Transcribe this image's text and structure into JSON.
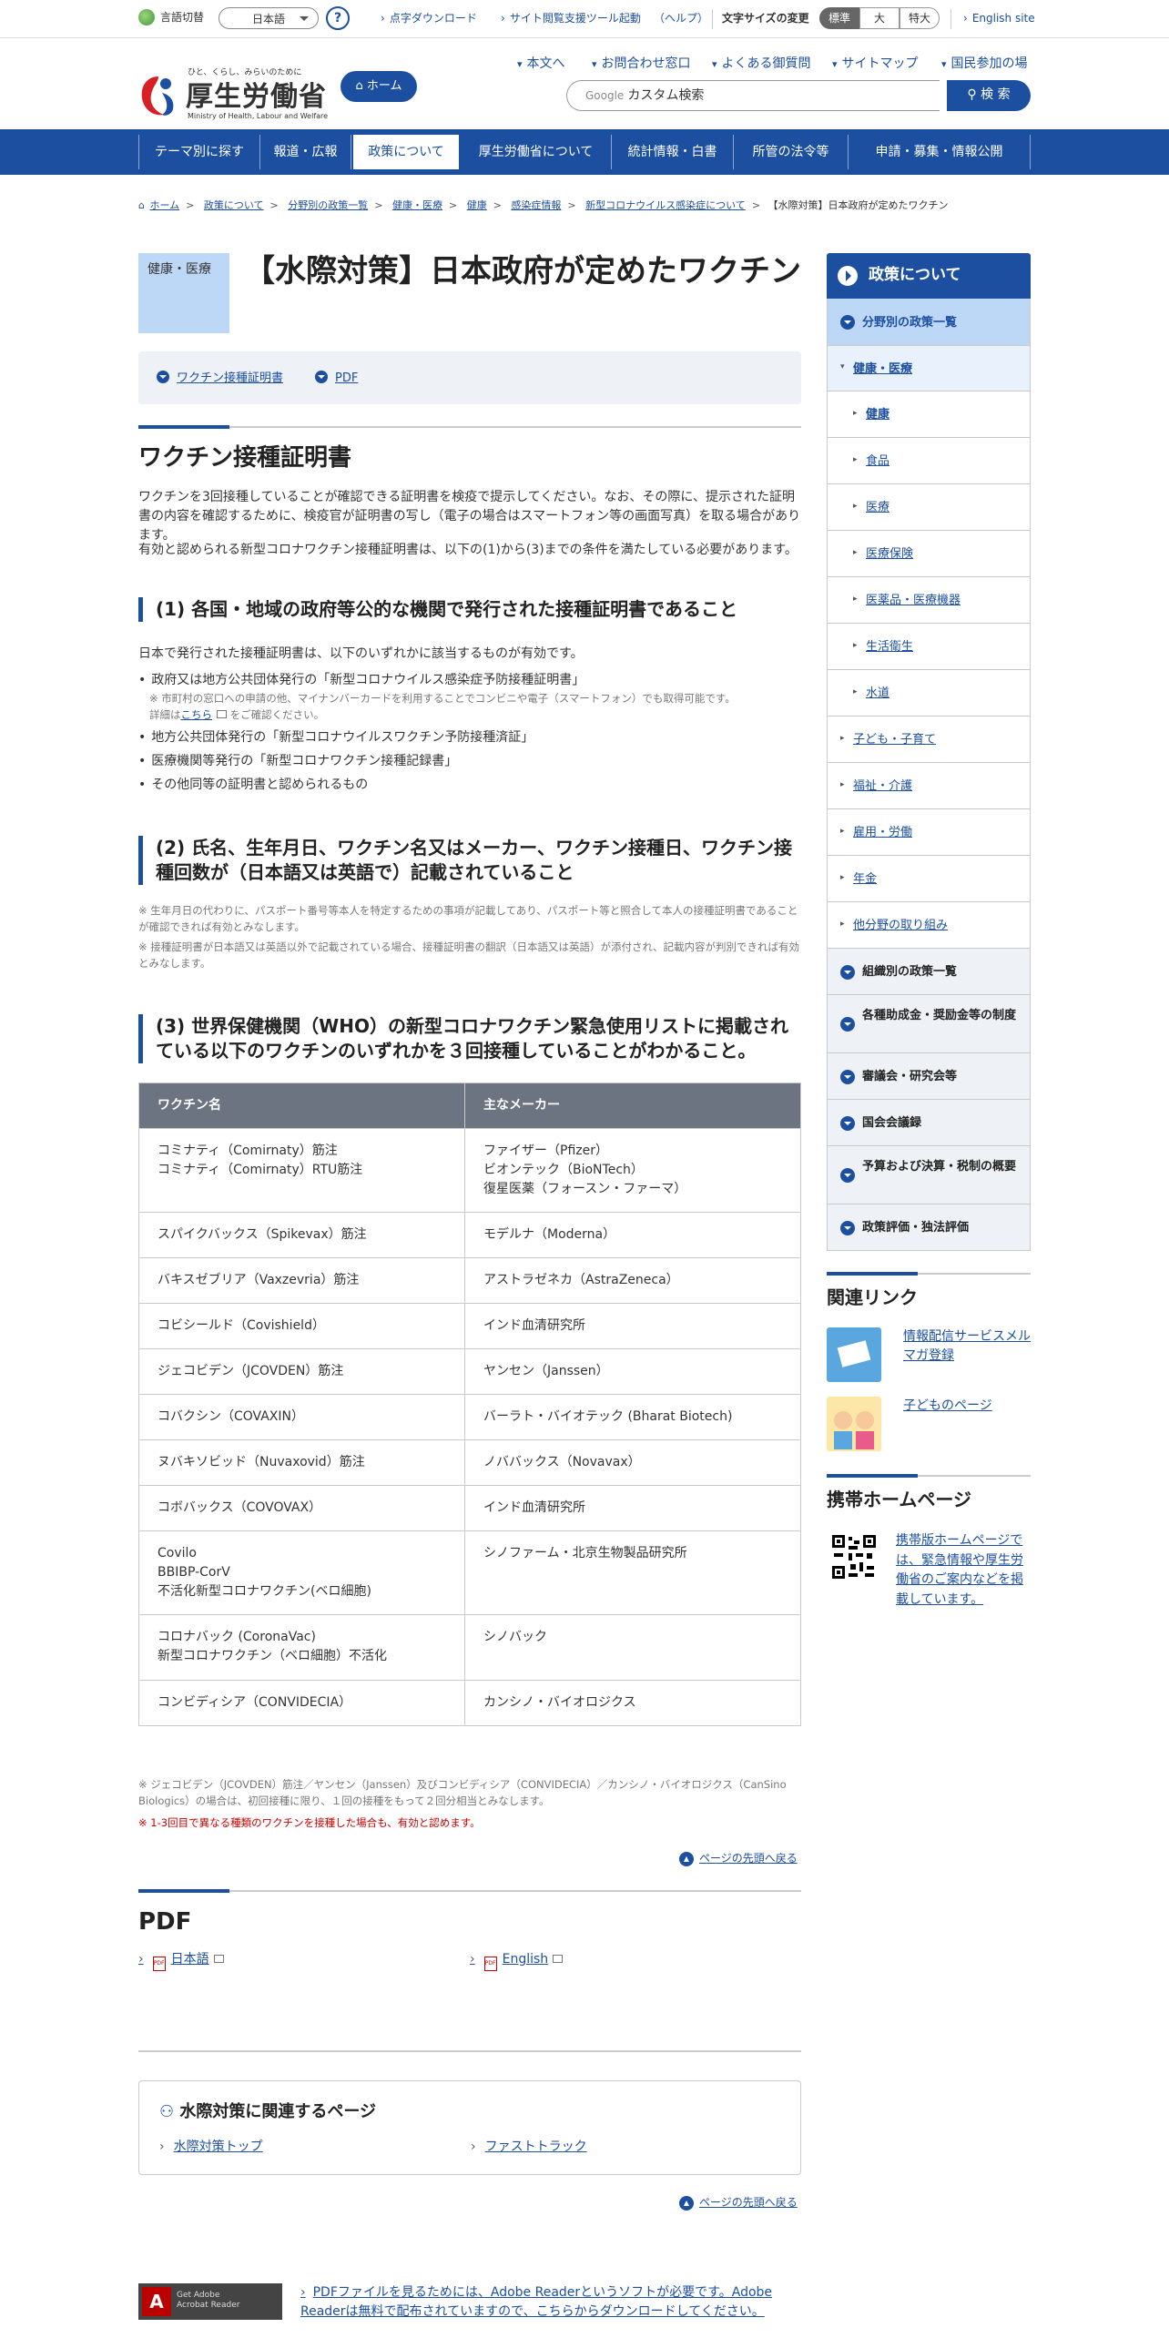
{
  "utility": {
    "lang_label": "言語切替",
    "lang_value": "日本語",
    "help": "?",
    "links": [
      "点字ダウンロード",
      "サイト閲覧支援ツール起動",
      "（ヘルプ）"
    ],
    "fontsize_label": "文字サイズの変更",
    "fontsize": [
      "標準",
      "大",
      "特大"
    ],
    "english": "English site"
  },
  "header": {
    "logo_tag": "ひと、くらし、みらいのために",
    "logo_name": "厚生労働省",
    "logo_en": "Ministry of Health, Labour and Welfare",
    "home": "ホーム",
    "links": [
      "本文へ",
      "お問合わせ窓口",
      "よくある御質問",
      "サイトマップ",
      "国民参加の場"
    ],
    "search_brand": "Google",
    "search_placeholder": "カスタム検索",
    "search_button": "検 索"
  },
  "gnav": [
    "テーマ別に探す",
    "報道・広報",
    "政策について",
    "厚生労働省について",
    "統計情報・白書",
    "所管の法令等",
    "申請・募集・情報公開"
  ],
  "breadcrumb": [
    "ホーム",
    "政策について",
    "分野別の政策一覧",
    "健康・医療",
    "健康",
    "感染症情報",
    "新型コロナウイルス感染症について",
    "【水際対策】日本政府が定めたワクチン"
  ],
  "page": {
    "category": "健康・医療",
    "title": "【水際対策】日本政府が定めたワクチン",
    "toc": [
      "ワクチン接種証明書",
      "PDF"
    ]
  },
  "section1": {
    "heading": "ワクチン接種証明書",
    "intro1": "ワクチンを3回接種していることが確認できる証明書を検疫で提示してください。なお、その際に、提示された証明書の内容を確認するために、検疫官が証明書の写し（電子の場合はスマートフォン等の画面写真）を取る場合があります。",
    "intro2": "有効と認められる新型コロナワクチン接種証明書は、以下の(1)から(3)までの条件を満たしている必要があります。",
    "c1_heading": "(1) 各国・地域の政府等公的な機関で発行された接種証明書であること",
    "c1_text": "日本で発行された接種証明書は、以下のいずれかに該当するものが有効です。",
    "c1_items": [
      "政府又は地方公共団体発行の「新型コロナウイルス感染症予防接種証明書」",
      "地方公共団体発行の「新型コロナウイルスワクチン予防接種済証」",
      "医療機関等発行の「新型コロナワクチン接種記録書」",
      "その他同等の証明書と認められるもの"
    ],
    "c1_note1": "※ 市町村の窓口への申請の他、マイナンバーカードを利用することでコンビニや電子（スマートフォン）でも取得可能です。",
    "c1_note2a": "詳細は",
    "c1_note2b": "こちら",
    "c1_note2c": "をご確認ください。",
    "c2_heading": "(2) 氏名、生年月日、ワクチン名又はメーカー、ワクチン接種日、ワクチン接種回数が（日本語又は英語で）記載されていること",
    "c2_note1": "※ 生年月日の代わりに、パスポート番号等本人を特定するための事項が記載してあり、パスポート等と照合して本人の接種証明書であることが確認できれば有効とみなします。",
    "c2_note2": "※ 接種証明書が日本語又は英語以外で記載されている場合、接種証明書の翻訳（日本語又は英語）が添付され、記載内容が判別できれば有効とみなします。",
    "c3_heading": "(3) 世界保健機関（WHO）の新型コロナワクチン緊急使用リストに掲載されている以下のワクチンのいずれかを３回接種していることがわかること。"
  },
  "vaccine_table": {
    "headers": [
      "ワクチン名",
      "主なメーカー"
    ],
    "rows": [
      {
        "name": [
          "コミナティ（Comirnaty）筋注",
          "コミナティ（Comirnaty）RTU筋注"
        ],
        "maker": [
          "ファイザー（Pfizer）",
          "ビオンテック（BioNTech）",
          "復星医薬（フォースン・ファーマ）"
        ]
      },
      {
        "name": [
          "スパイクバックス（Spikevax）筋注"
        ],
        "maker": [
          "モデルナ（Moderna）"
        ]
      },
      {
        "name": [
          "バキスゼブリア（Vaxzevria）筋注"
        ],
        "maker": [
          "アストラゼネカ（AstraZeneca）"
        ]
      },
      {
        "name": [
          "コビシールド（Covishield）"
        ],
        "maker": [
          "インド血清研究所"
        ]
      },
      {
        "name": [
          "ジェコビデン（JCOVDEN）筋注"
        ],
        "maker": [
          "ヤンセン（Janssen）"
        ]
      },
      {
        "name": [
          "コバクシン（COVAXIN）"
        ],
        "maker": [
          "バーラト・バイオテック (Bharat Biotech)"
        ]
      },
      {
        "name": [
          "ヌバキソビッド（Nuvaxovid）筋注"
        ],
        "maker": [
          "ノババックス（Novavax）"
        ]
      },
      {
        "name": [
          "コボバックス（COVOVAX）"
        ],
        "maker": [
          "インド血清研究所"
        ]
      },
      {
        "name": [
          "Covilo",
          "BBIBP-CorV",
          "不活化新型コロナワクチン(ベロ細胞)"
        ],
        "maker": [
          "シノファーム・北京生物製品研究所"
        ]
      },
      {
        "name": [
          "コロナバック (CoronaVac)",
          "新型コロナワクチン（ベロ細胞）不活化"
        ],
        "maker": [
          "シノバック"
        ]
      },
      {
        "name": [
          "コンビディシア（CONVIDECIA）"
        ],
        "maker": [
          "カンシノ・バイオロジクス"
        ]
      }
    ]
  },
  "table_notes": {
    "note1": "※ ジェコビデン（JCOVDEN）筋注／ヤンセン（Janssen）及びコンビディシア（CONVIDECIA）／カンシノ・バイオロジクス（CanSino Biologics）の場合は、初回接種に限り、１回の接種をもって２回分相当とみなします。",
    "note2": "※ 1-3回目で異なる種類のワクチンを接種した場合も、有効と認めます。"
  },
  "to_top": "ページの先頭へ戻る",
  "pdf_section": {
    "heading": "PDF",
    "links": [
      "日本語",
      "English"
    ],
    "icon": "PDF"
  },
  "related_pages": {
    "title": "水際対策に関連するページ",
    "links": [
      "水際対策トップ",
      "ファストトラック"
    ]
  },
  "adobe": {
    "badge1": "Get Adobe",
    "badge2": "Acrobat Reader",
    "text": "PDFファイルを見るためには、Adobe Readerというソフトが必要です。Adobe Readerは無料で配布されていますので、こちらからダウンロードしてください。"
  },
  "sidebar": {
    "title": "政策について",
    "items": [
      "分野別の政策一覧",
      "健康・医療",
      "健康",
      "食品",
      "医療",
      "医療保険",
      "医薬品・医療機器",
      "生活衛生",
      "水道",
      "子ども・子育て",
      "福祉・介護",
      "雇用・労働",
      "年金",
      "他分野の取り組み",
      "組織別の政策一覧",
      "各種助成金・奨励金等の制度",
      "審議会・研究会等",
      "国会会議録",
      "予算および決算・税制の概要",
      "政策評価・独法評価"
    ],
    "related_title": "関連リンク",
    "related": [
      "情報配信サービスメルマガ登録",
      "子どものページ"
    ],
    "mobile_title": "携帯ホームページ",
    "mobile_text": "携帯版ホームページでは、緊急情報や厚生労働省のご案内などを掲載しています。"
  },
  "colors": {
    "primary": "#1c4fa0",
    "badge": "#bdd7f7",
    "table_header": "#6d7481",
    "note_red": "#cc0000"
  }
}
